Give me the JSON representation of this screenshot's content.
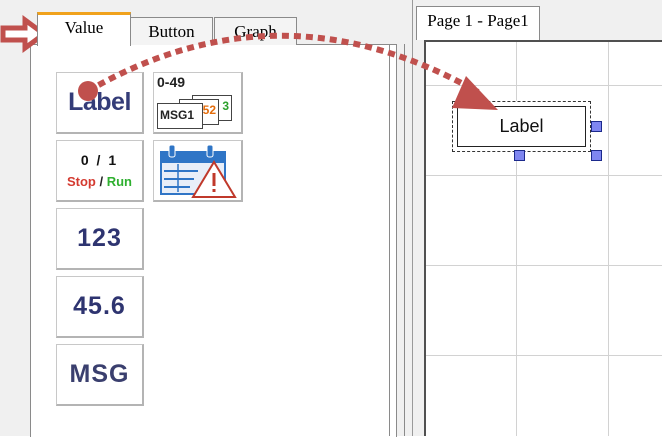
{
  "left": {
    "tabs": [
      {
        "label": "Value",
        "active": true
      },
      {
        "label": "Button",
        "active": false
      },
      {
        "label": "Graph",
        "active": false
      }
    ],
    "tools": {
      "label_text": "Label",
      "msg_range": "0-49",
      "msg_card_front": "MSG1",
      "msg_card_back": "52",
      "msg_card_back2": "3",
      "bit_values": "0 / 1",
      "bit_stop": "Stop",
      "bit_slash": " / ",
      "bit_run": "Run",
      "integer": "123",
      "float": "45.6",
      "msg": "MSG"
    }
  },
  "right": {
    "page_tab": "Page 1 - Page1",
    "widget_label": "Label"
  },
  "colors": {
    "annotation_red": "#c0504d",
    "tab_highlight": "#f0a21c",
    "handle": "#7f86f0"
  },
  "icons": [
    "arrow-right-icon",
    "calendar-alarm-icon"
  ]
}
